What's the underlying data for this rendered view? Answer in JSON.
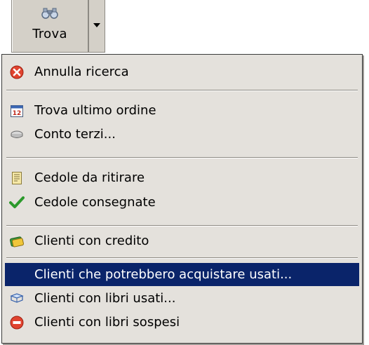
{
  "toolbar": {
    "button_label": "Trova",
    "button_icon": "binoculars-icon",
    "dropdown_icon": "chevron-down-icon"
  },
  "menu": {
    "selected_color": "#0a246a",
    "items": [
      {
        "label": "Annulla ricerca",
        "icon": "cancel-red-x-icon"
      },
      {
        "label": "Trova ultimo ordine",
        "icon": "calendar-icon"
      },
      {
        "label": "Conto terzi...",
        "icon": "disk-drive-icon"
      },
      {
        "label": "Cedole da ritirare",
        "icon": "document-icon"
      },
      {
        "label": "Cedole consegnate",
        "icon": "checkmark-icon"
      },
      {
        "label": "Clienti con credito",
        "icon": "credit-card-icon"
      },
      {
        "label": "Clienti che potrebbero acquistare usati...",
        "icon": "",
        "selected": true
      },
      {
        "label": "Clienti con libri usati...",
        "icon": "book-icon"
      },
      {
        "label": "Clienti con libri sospesi",
        "icon": "no-entry-icon"
      }
    ]
  }
}
